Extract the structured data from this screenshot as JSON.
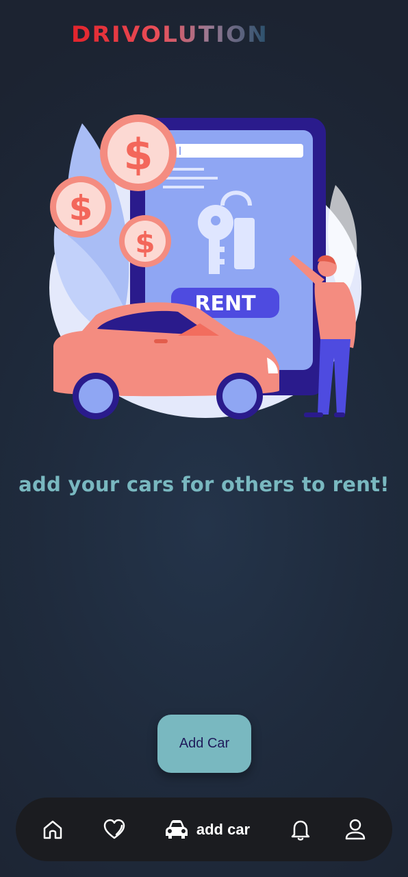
{
  "header": {
    "logo_text": "DRIVOLUTION"
  },
  "hero": {
    "sign_text": "RENT",
    "coin_symbol": "$"
  },
  "main": {
    "tagline": "add your cars for others to rent!",
    "add_button_label": "Add Car"
  },
  "bottom_nav": {
    "items": [
      {
        "icon": "home-icon",
        "label": ""
      },
      {
        "icon": "heart-icon",
        "label": ""
      },
      {
        "icon": "car-icon",
        "label": "add car",
        "active": true
      },
      {
        "icon": "bell-icon",
        "label": ""
      },
      {
        "icon": "user-icon",
        "label": ""
      }
    ]
  },
  "colors": {
    "accent": "#79b8c0",
    "nav_bg": "#1b1c20",
    "logo_red": "#e3232b",
    "logo_blue": "#2f5d7a"
  }
}
